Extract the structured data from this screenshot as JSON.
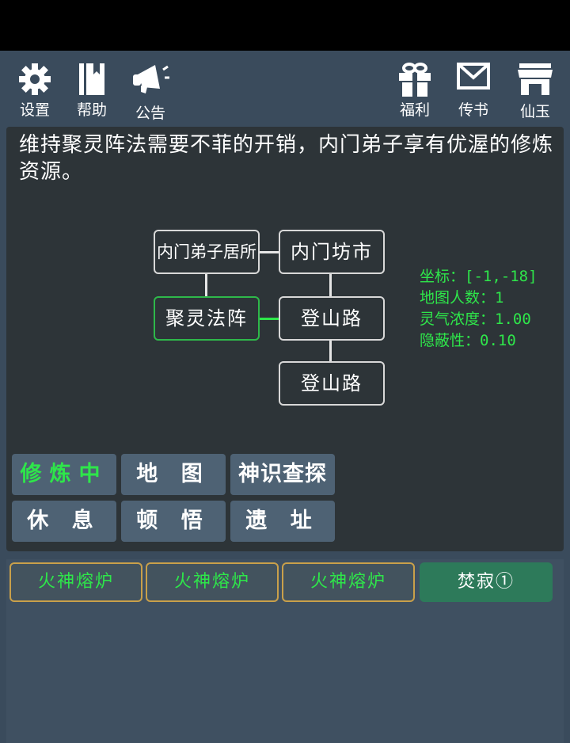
{
  "header": {
    "left": [
      {
        "label": "设置",
        "icon": "gear-icon"
      },
      {
        "label": "帮助",
        "icon": "book-icon"
      },
      {
        "label": "公告",
        "icon": "megaphone-icon"
      }
    ],
    "right": [
      {
        "label": "福利",
        "icon": "gift-icon"
      },
      {
        "label": "传书",
        "icon": "mail-icon"
      },
      {
        "label": "仙玉",
        "icon": "shop-icon"
      }
    ]
  },
  "description": "维持聚灵阵法需要不菲的开销，内门弟子享有优渥的修炼资源。",
  "map": {
    "nodes": [
      {
        "label": "内门弟子居所"
      },
      {
        "label": "内门坊市"
      },
      {
        "label": "聚灵法阵",
        "current": true
      },
      {
        "label": "登山路"
      },
      {
        "label": "登山路"
      }
    ]
  },
  "info": {
    "coord": "坐标：[-1,-18]",
    "population": "地图人数：1",
    "spirit": "灵气浓度：1.00",
    "stealth": "隐蔽性：0.10"
  },
  "actions": [
    {
      "label": "修炼中",
      "active": true
    },
    {
      "label": "地 图"
    },
    {
      "label": "神识查探"
    },
    {
      "label": "休 息"
    },
    {
      "label": "顿 悟"
    },
    {
      "label": "遗 址"
    }
  ],
  "slots": [
    {
      "label": "火神熔炉"
    },
    {
      "label": "火神熔炉"
    },
    {
      "label": "火神熔炉"
    }
  ],
  "burn_button": "焚寂①",
  "colors": {
    "background": "#3a4b5c",
    "panel": "#2d3438",
    "accent_green": "#2ee64a",
    "slot_border": "#c9a04a",
    "burn_button": "#2d7a5a"
  }
}
